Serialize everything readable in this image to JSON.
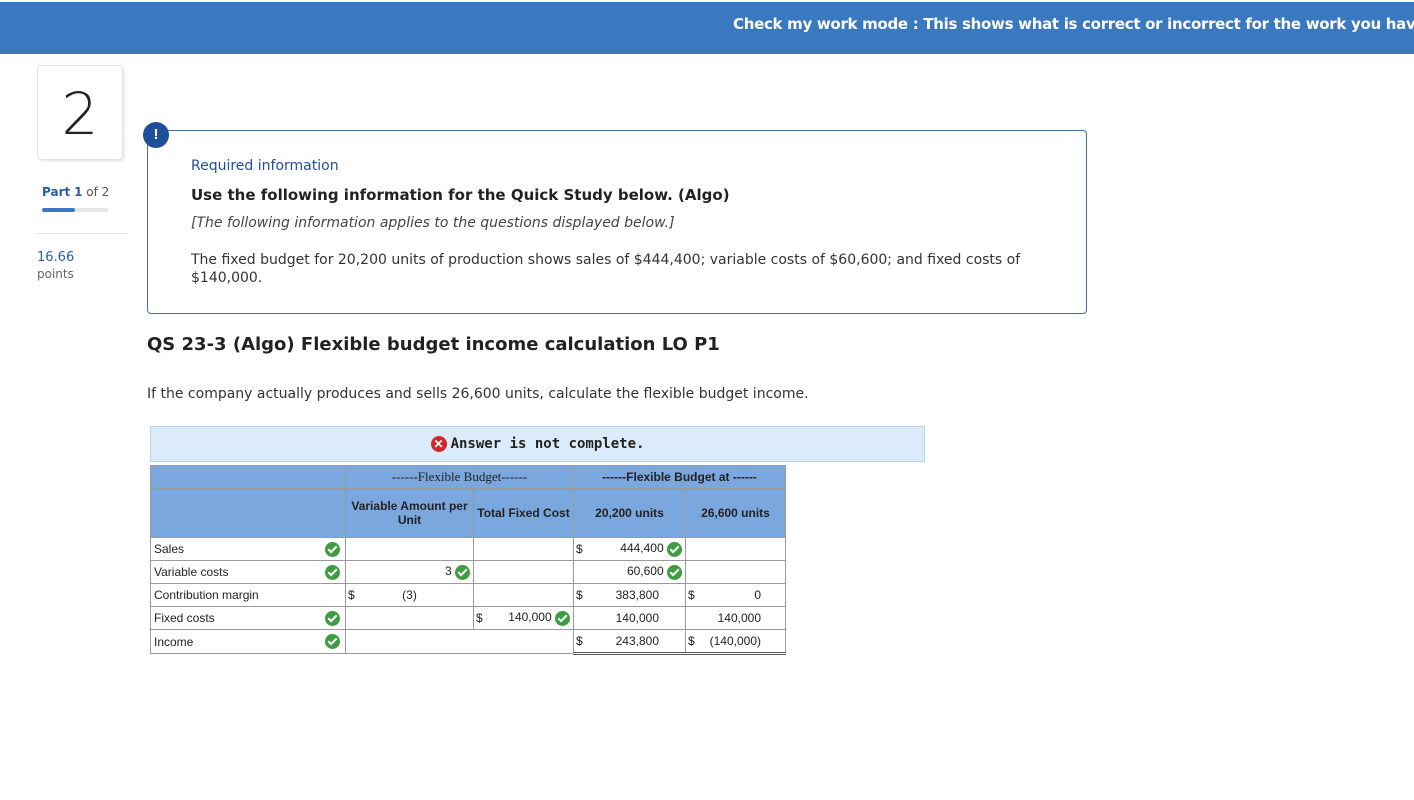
{
  "topbar": {
    "message": "Check my work mode : This shows what is correct or incorrect for the work you have completed"
  },
  "sidebar": {
    "question_number": "2",
    "part_label": "Part",
    "part_current": "1",
    "part_of": "of 2",
    "progress": 0.5,
    "points_value": "16.66",
    "points_label": "points"
  },
  "info": {
    "badge": "!",
    "required": "Required information",
    "use_heading": "Use the following information for the Quick Study below. (Algo)",
    "applies": "[The following information applies to the questions displayed below.]",
    "body": "The fixed budget for 20,200 units of production shows sales of $444,400; variable costs of $60,600; and fixed costs of $140,000."
  },
  "question": {
    "title": "QS 23-3 (Algo) Flexible budget income calculation LO P1",
    "prompt": "If the company actually produces and sells 26,600 units, calculate the flexible budget income."
  },
  "answer_status": {
    "icon": "✕",
    "text": "Answer is not complete."
  },
  "table": {
    "header1": {
      "flex": "------Flexible Budget------",
      "flex_at": "------Flexible Budget at ------"
    },
    "header2": {
      "variable": "Variable Amount per Unit",
      "total_fixed": "Total Fixed Cost",
      "units1": "20,200 units",
      "units2": "26,600 units"
    },
    "rows": {
      "sales": {
        "label": "Sales",
        "dollar": "$",
        "fb1": "444,400"
      },
      "variable": {
        "label": "Variable costs",
        "var": "3",
        "fb1": "60,600"
      },
      "contribution": {
        "label": "Contribution margin",
        "dollar_var": "$",
        "var": "(3)",
        "dollar_fb1": "$",
        "fb1": "383,800",
        "dollar_fb2": "$",
        "fb2": "0"
      },
      "fixed": {
        "label": "Fixed costs",
        "dollar_tf": "$",
        "tf": "140,000",
        "fb1": "140,000",
        "fb2": "140,000"
      },
      "income": {
        "label": "Income",
        "dollar_fb1": "$",
        "fb1": "243,800",
        "dollar_fb2": "$",
        "fb2": "(140,000)"
      }
    }
  },
  "colors": {
    "topbar": "#3a78bf",
    "header": "#7aa7de",
    "check": "#3f9d41",
    "error": "#d0292d"
  }
}
